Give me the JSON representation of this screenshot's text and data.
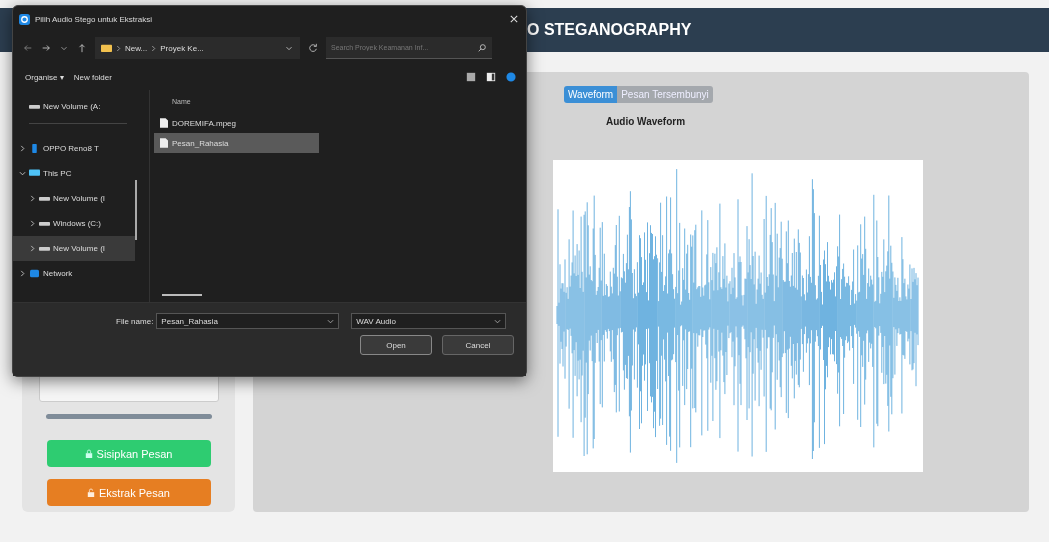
{
  "header": {
    "title": "O STEGANOGRAPHY"
  },
  "left_panel": {
    "buttons": [
      {
        "label": "Sisipkan Pesan",
        "kind": "embed"
      },
      {
        "label": "Ekstrak Pesan",
        "kind": "extract"
      }
    ]
  },
  "tabs": [
    {
      "label": "Waveform",
      "selected": true
    },
    {
      "label": "Pesan Tersembunyi",
      "selected": false
    }
  ],
  "chart": {
    "title": "Audio Waveform"
  },
  "dialog": {
    "title": "Pilih Audio Stego untuk Ekstraksi",
    "breadcrumb": [
      "New...",
      "Proyek Ke..."
    ],
    "search": {
      "placeholder": "Search Proyek Keamanan Inf..."
    },
    "toolbar": [
      "Organise ▾",
      "New folder"
    ],
    "nav": [
      {
        "label": "New Volume (A:",
        "kind": "drive",
        "selected": false
      },
      {
        "label": "OPPO Reno8 T",
        "kind": "phone",
        "expanded": false,
        "selected": false
      },
      {
        "label": "This PC",
        "kind": "pc",
        "expanded": true,
        "selected": false,
        "children": [
          {
            "label": "New Volume (I",
            "kind": "drive",
            "expanded": false,
            "selected": false
          },
          {
            "label": "Windows (C:)",
            "kind": "drive",
            "expanded": false,
            "selected": false
          },
          {
            "label": "New Volume (I",
            "kind": "drive",
            "expanded": false,
            "selected": true
          }
        ]
      },
      {
        "label": "Network",
        "kind": "network",
        "expanded": false,
        "selected": false
      }
    ],
    "column": "Name",
    "files": [
      {
        "name": "DOREMIFA.mpeg",
        "selected": false
      },
      {
        "name": "Pesan_Rahasia",
        "selected": true
      }
    ],
    "file_name_label": "File name:",
    "file_name": "Pesan_Rahasia",
    "file_type": "WAV Audio",
    "buttons": [
      "Open",
      "Cancel"
    ]
  }
}
